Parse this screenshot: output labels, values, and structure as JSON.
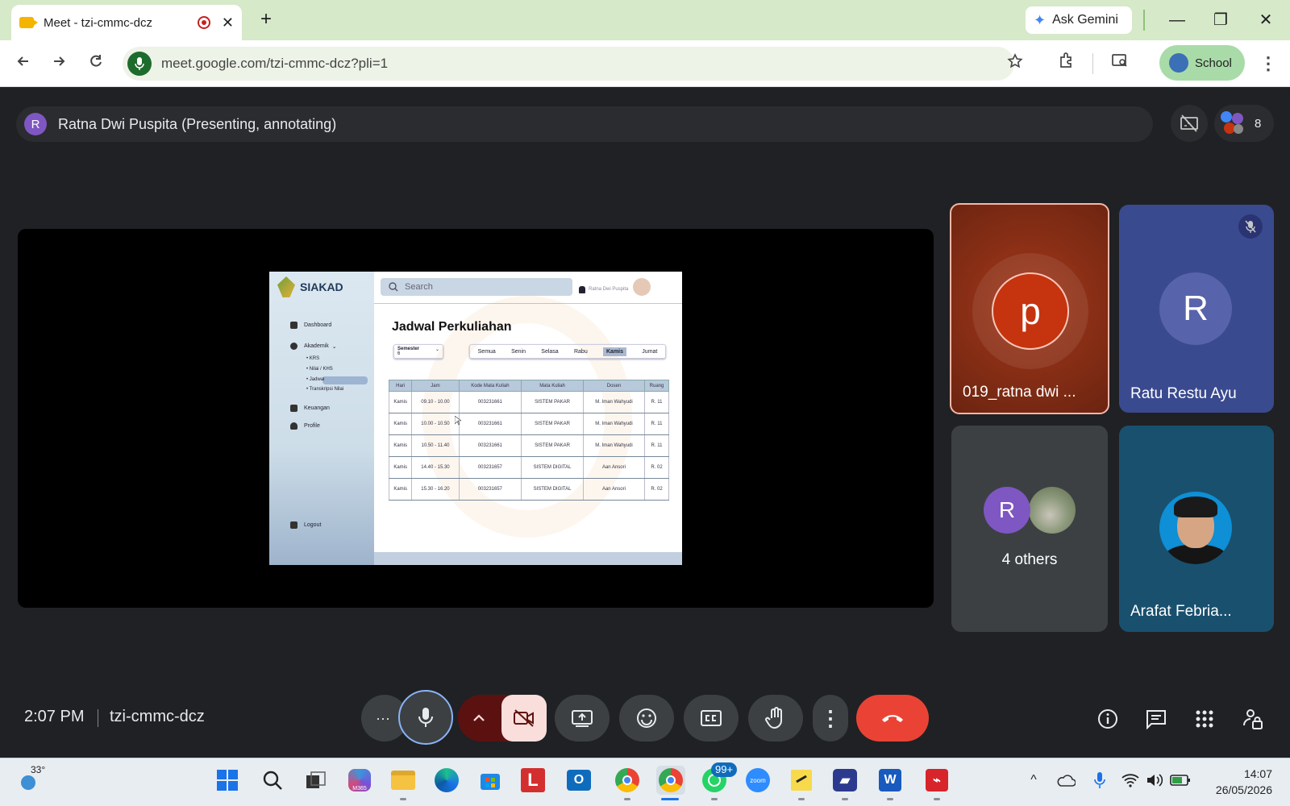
{
  "browser": {
    "tab_title": "Meet - tzi-cmmc-dcz",
    "tab_close": "✕",
    "new_tab": "+",
    "ask_gemini": "Ask Gemini",
    "url": "meet.google.com/tzi-cmmc-dcz?pli=1",
    "profile_label": "School",
    "win_min": "—",
    "win_restore": "❐",
    "win_close": "✕"
  },
  "meet": {
    "presenter_initial": "R",
    "presenter_text": "Ratna Dwi Puspita (Presenting, annotating)",
    "participant_count": "8",
    "clock": "2:07 PM",
    "meeting_code": "tzi-cmmc-dcz",
    "more_label": "···",
    "participants": [
      {
        "initial": "p",
        "name": "019_ratna dwi ...",
        "accent": "#c5330f"
      },
      {
        "initial": "R",
        "name": "Ratu Restu Ayu",
        "muted": true
      },
      {
        "initial": "R",
        "label": "4 others"
      },
      {
        "name": "Arafat Febria..."
      }
    ]
  },
  "slide": {
    "app_name": "SIAKAD",
    "search_placeholder": "Search",
    "user_name": "Ratna Dwi Puspita",
    "nav": [
      "Dashboard",
      "Akademik",
      "Keuangan",
      "Profile",
      "Logout"
    ],
    "akademik_chevron": "⌄",
    "subnav": [
      "KRS",
      "Nilai / KHS",
      "Jadwal",
      "Transkripsi Nilai"
    ],
    "heading": "Jadwal Perkuliahan",
    "semester_label": "Semester",
    "semester_value": "6",
    "semester_chevron": "⌄",
    "days": [
      "Semua",
      "Senin",
      "Selasa",
      "Rabu",
      "Kamis",
      "Jumat"
    ],
    "active_day": "Kamis",
    "columns": [
      "Hari",
      "Jam",
      "Kode Mata Kuliah",
      "Mata Kuliah",
      "Dosen",
      "Ruang"
    ],
    "rows": [
      [
        "Kamis",
        "09.10 - 10.00",
        "003231661",
        "SISTEM PAKAR",
        "M. Iman Wahyudi",
        "R. 11"
      ],
      [
        "Kamis",
        "10.00 - 10.50",
        "003231661",
        "SISTEM PAKAR",
        "M. Iman Wahyudi",
        "R. 11"
      ],
      [
        "Kamis",
        "10.50 - 11.40",
        "003231661",
        "SISTEM PAKAR",
        "M. Iman Wahyudi",
        "R. 11"
      ],
      [
        "Kamis",
        "14.40 - 15.30",
        "003231657",
        "SISTEM DIGITAL",
        "Aan Ansori",
        "R. 02"
      ],
      [
        "Kamis",
        "15.30 - 16.20",
        "003231657",
        "SISTEM DIGITAL",
        "Aan Ansori",
        "R. 02"
      ]
    ]
  },
  "taskbar": {
    "weather_temp": "33°",
    "whatsapp_badge": "99+",
    "m365_label": "M365",
    "zoom_label": "zoom",
    "time": "14:07",
    "date": "26/05/2026"
  }
}
